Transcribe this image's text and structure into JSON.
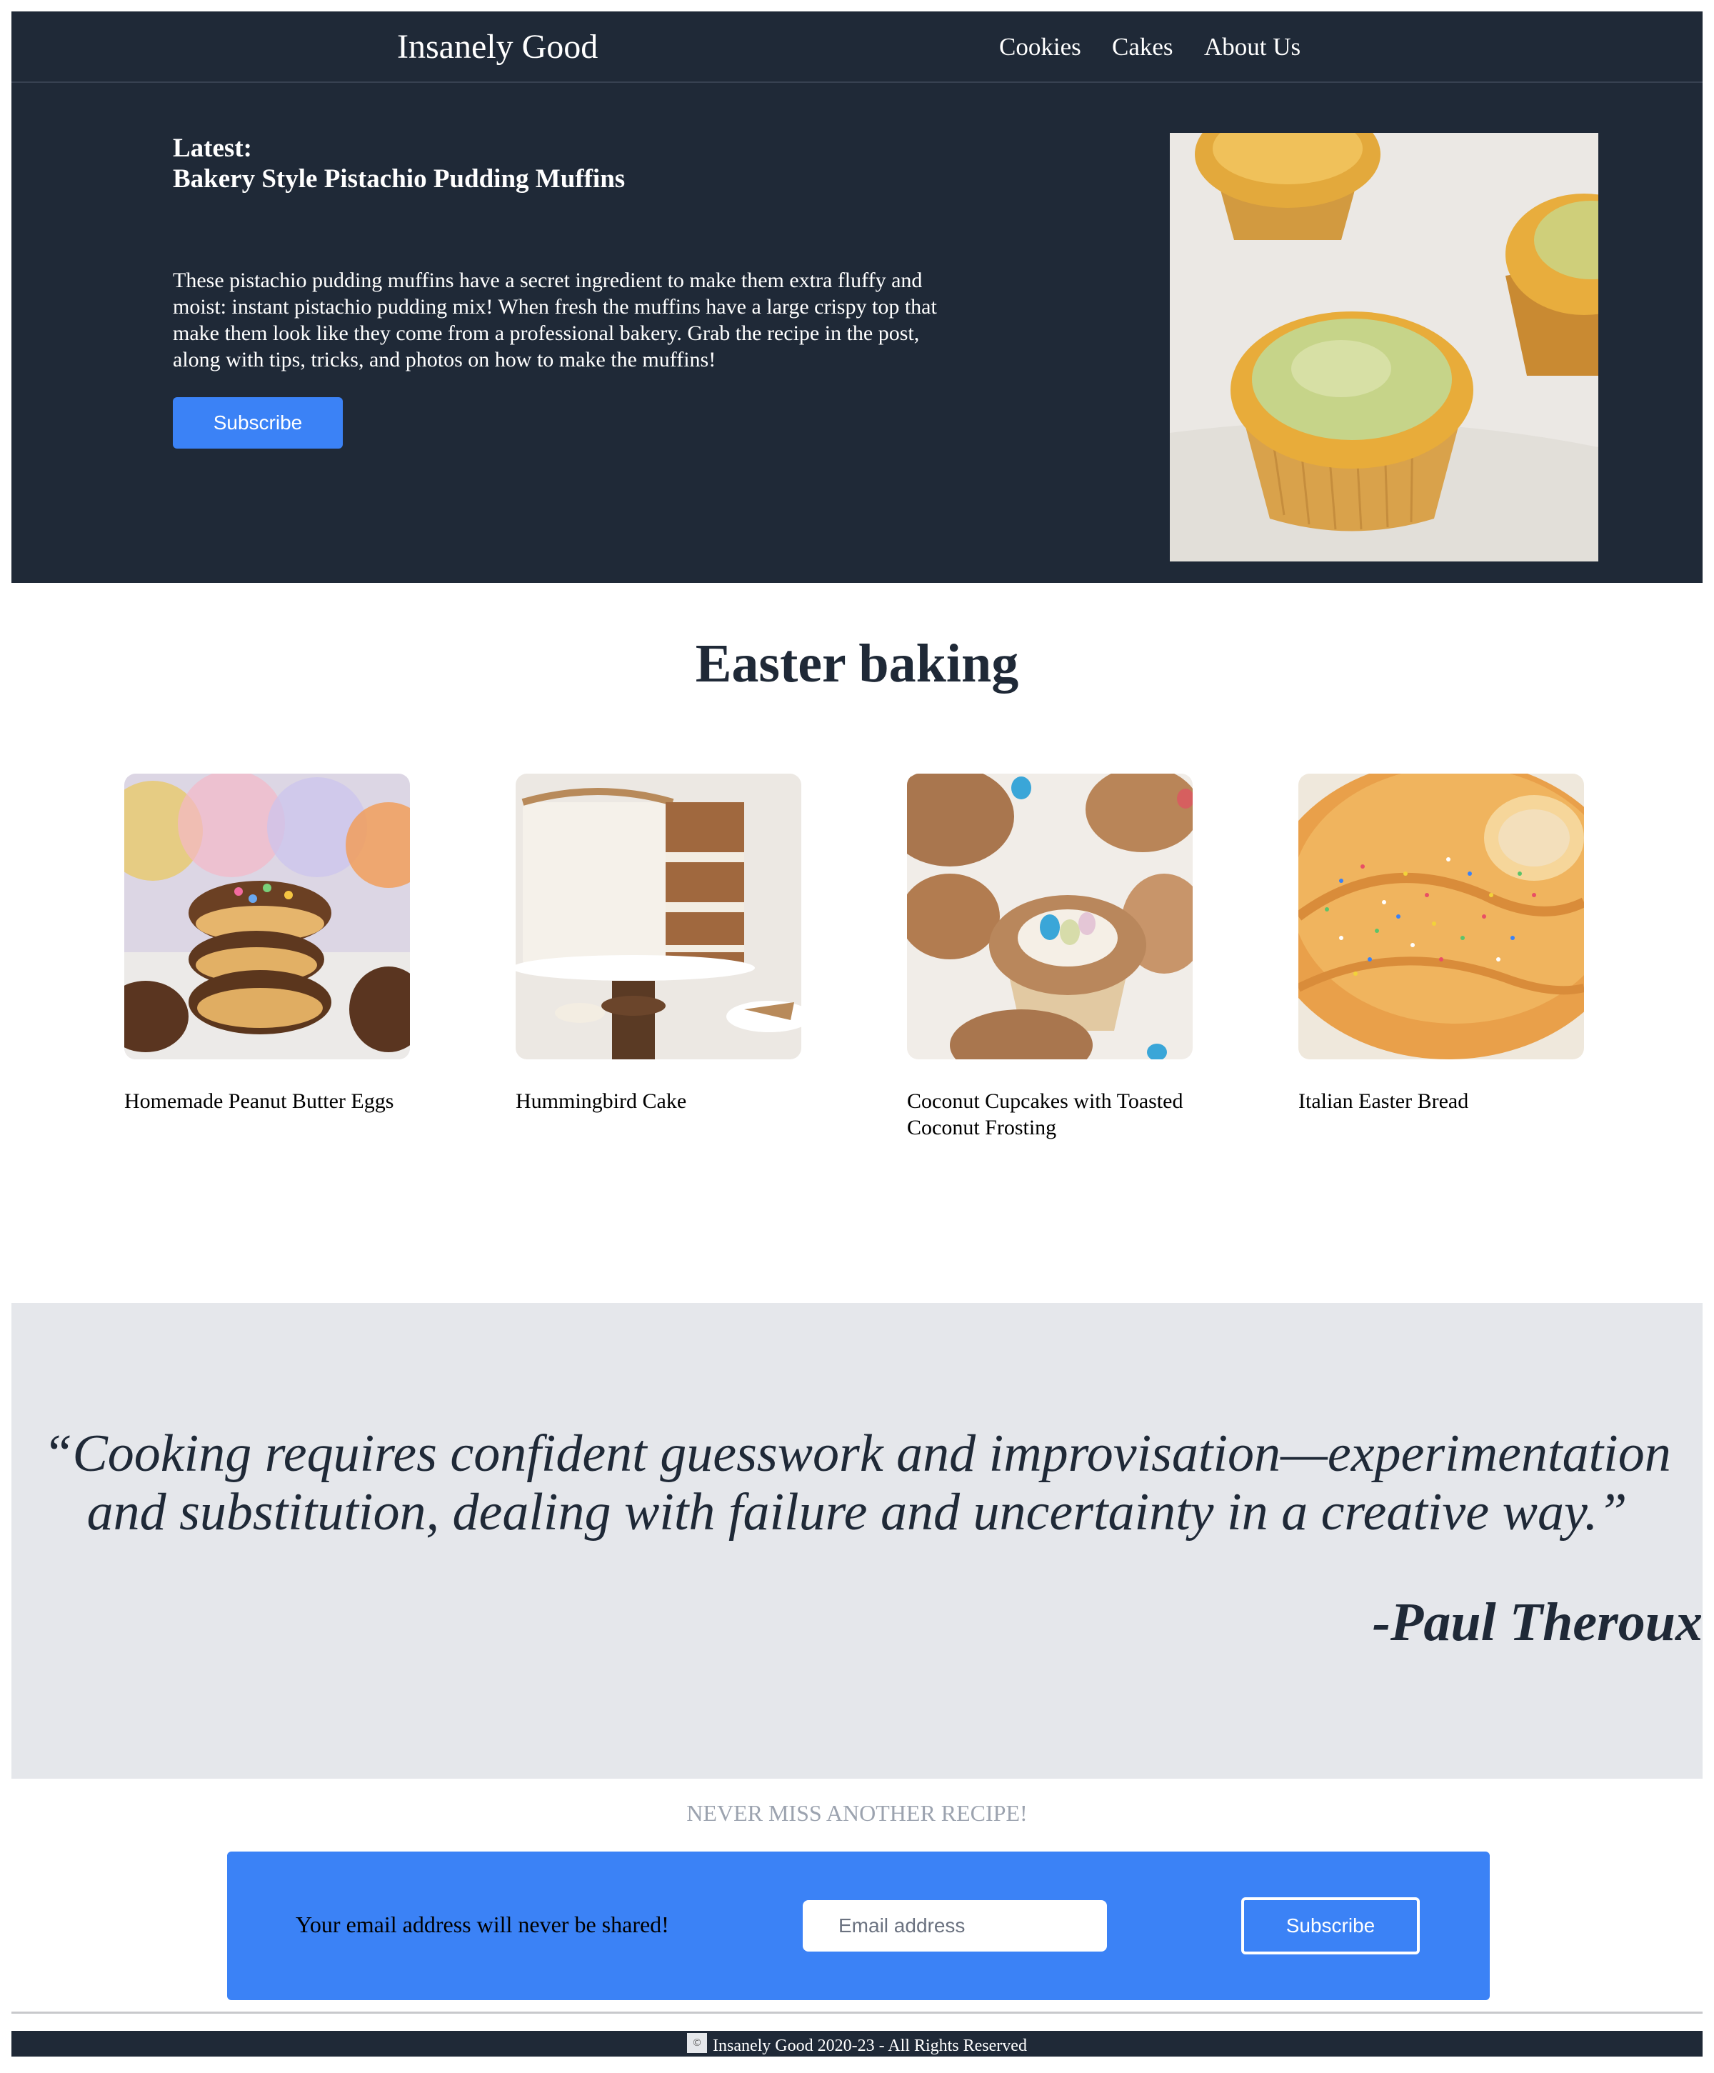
{
  "nav": {
    "brand": "Insanely Good",
    "links": [
      "Cookies",
      "Cakes",
      "About Us"
    ]
  },
  "hero": {
    "label": "Latest:",
    "title": "Bakery Style Pistachio Pudding Muffins",
    "description": "These pistachio pudding muffins have a secret ingredient to make them extra fluffy and moist: instant pistachio pudding mix! When fresh the muffins have a large crispy top that make them look like they come from a professional bakery. Grab the recipe in the post, along with tips, tricks, and photos on how to make the muffins!",
    "button": "Subscribe",
    "image_icon": "pistachio-muffins-photo"
  },
  "easter": {
    "title": "Easter baking",
    "cards": [
      {
        "title": "Homemade Peanut Butter Eggs",
        "image_icon": "peanut-butter-eggs-photo"
      },
      {
        "title": "Hummingbird Cake",
        "image_icon": "hummingbird-cake-photo"
      },
      {
        "title": "Coconut Cupcakes with Toasted Coconut Frosting",
        "image_icon": "coconut-cupcakes-photo"
      },
      {
        "title": "Italian Easter Bread",
        "image_icon": "italian-easter-bread-photo"
      }
    ]
  },
  "quote": {
    "text": "“Cooking requires confident guesswork and improvisation—experimentation and substitution, dealing with failure and uncertainty in a creative way.”",
    "author": "-Paul Theroux"
  },
  "newsletter": {
    "heading": "NEVER MISS ANOTHER RECIPE!",
    "note": "Your email address will never be shared!",
    "email_placeholder": "Email address",
    "button": "Subscribe"
  },
  "footer": {
    "icon": "copyright-icon",
    "text": "Insanely Good 2020-23 - All Rights Reserved"
  },
  "colors": {
    "dark": "#1f2937",
    "accent": "#3b82f6",
    "quote_bg": "#e5e7eb",
    "muted": "#9ca3af"
  }
}
